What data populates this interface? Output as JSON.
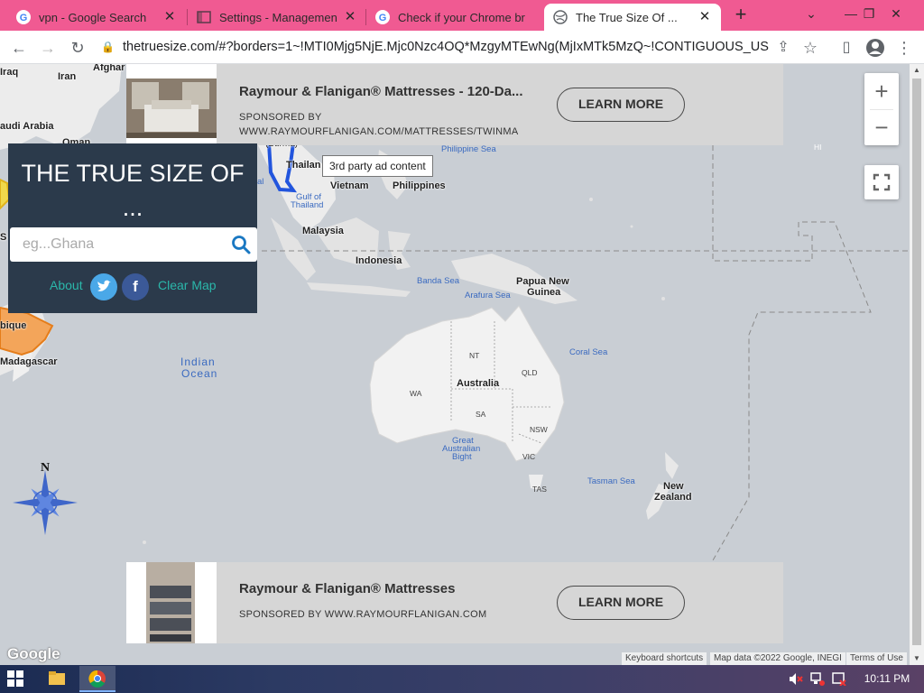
{
  "browser": {
    "tabs": [
      {
        "title": "vpn - Google Search",
        "icon": "google-icon"
      },
      {
        "title": "Settings - Management",
        "icon": "settings-page-icon"
      },
      {
        "title": "Check if your Chrome br",
        "icon": "google-icon"
      },
      {
        "title": "The True Size Of ...",
        "icon": "globe-icon",
        "active": true
      }
    ],
    "url": "thetruesize.com/#?borders=1~!MTI0Mjg5NjE.Mjc0Nzc4OQ*MzgyMTEwNg(MjIxMTk5MzQ~!CONTIGUOUS_US*..."
  },
  "ads": {
    "top": {
      "headline": "Raymour & Flanigan® Mattresses - 120-Da...",
      "sponsor_label": "SPONSORED BY",
      "sponsor_url": "WWW.RAYMOURFLANIGAN.COM/MATTRESSES/TWINMA",
      "button": "LEARN MORE"
    },
    "bottom": {
      "headline": "Raymour & Flanigan® Mattresses",
      "sponsor": "SPONSORED BY WWW.RAYMOURFLANIGAN.COM",
      "button": "LEARN MORE"
    },
    "tooltip": "3rd party ad content"
  },
  "panel": {
    "title_line1": "THE TRUE SIZE OF",
    "title_line2": "...",
    "search_placeholder": "eg...Ghana",
    "about": "About",
    "clear": "Clear Map"
  },
  "map": {
    "countries": {
      "iraq": "Iraq",
      "iran": "Iran",
      "afghanistan": "Afghar",
      "saudi": "audi Arabia",
      "oman": "Oman",
      "thailand": "Thailan",
      "vietnam": "Vietnam",
      "philippines": "Philippines",
      "malaysia": "Malaysia",
      "indonesia": "Indonesia",
      "png_1": "Papua New",
      "png_2": "Guinea",
      "australia": "Australia",
      "nz_1": "New",
      "nz_2": "Zealand",
      "mozambique": "bique",
      "madagascar": "Madagascar",
      "myanmar": "(Burma)",
      "so": "S"
    },
    "seas": {
      "philippine": "Philippine Sea",
      "thailand_gulf_1": "Gulf of",
      "thailand_gulf_2": "Thailand",
      "banda": "Banda Sea",
      "arafura": "Arafura Sea",
      "coral": "Coral Sea",
      "tasman": "Tasman Sea",
      "bight_1": "Great",
      "bight_2": "Australian",
      "bight_3": "Bight",
      "indian_1": "Indian",
      "indian_2": "Ocean",
      "ai": "al"
    },
    "states": {
      "nt": "NT",
      "qld": "QLD",
      "wa": "WA",
      "sa": "SA",
      "nsw": "NSW",
      "vic": "VIC",
      "tas": "TAS",
      "hi": "HI"
    },
    "compass_n": "N",
    "google": "Google",
    "attribution": {
      "shortcuts": "Keyboard shortcuts",
      "data": "Map data ©2022 Google, INEGI",
      "terms": "Terms of Use"
    },
    "zoom_in": "+",
    "zoom_out": "−"
  },
  "taskbar": {
    "time": "10:11 PM"
  },
  "colors": {
    "tabbar": "#f05a92",
    "panel": "#2b3a4b",
    "accent": "#2bb7aa",
    "highlight_blue": "#2255dd"
  }
}
